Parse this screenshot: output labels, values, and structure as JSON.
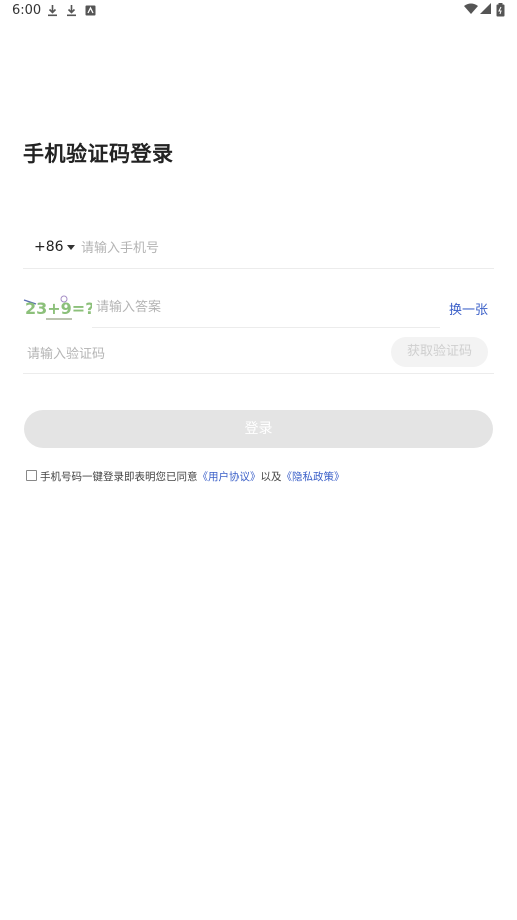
{
  "status_bar": {
    "time": "6:00",
    "icons": [
      "download-icon",
      "download-icon",
      "app-notification-icon",
      "wifi-icon",
      "signal-icon",
      "battery-icon"
    ]
  },
  "title": "手机验证码登录",
  "phone": {
    "country_code": "+86",
    "placeholder": "请输入手机号"
  },
  "captcha": {
    "image_text": "23+9=?",
    "placeholder": "请输入答案",
    "refresh_label": "换一张"
  },
  "sms": {
    "placeholder": "请输入验证码",
    "get_code_label": "获取验证码"
  },
  "login_label": "登录",
  "agreement": {
    "prefix": "手机号码一键登录即表明您已同意",
    "user_agreement": "《用户协议》",
    "conjunction": "以及",
    "privacy_policy": "《隐私政策》"
  },
  "colors": {
    "accent_link": "#3a5fc8",
    "button_disabled": "#e4e4e4"
  }
}
